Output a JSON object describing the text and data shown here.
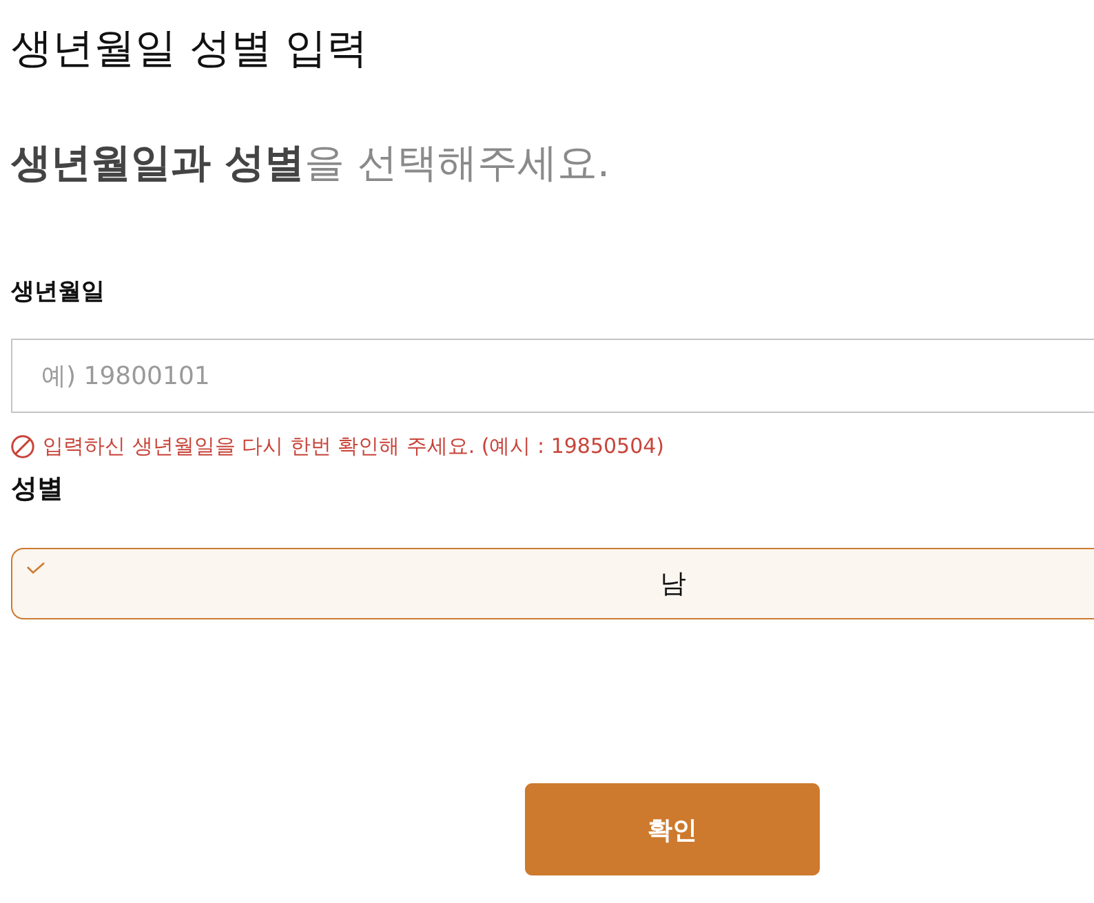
{
  "page": {
    "title": "생년월일 성별 입력",
    "subtitle": "**생년월일과 성별**을 선택해주세요."
  },
  "birthdate": {
    "label": "생년월일",
    "placeholder": "예) 19800101",
    "error": "입력하신 생년월일을 다시 한번 확인해 주세요. (예시 : 19850504)"
  },
  "gender": {
    "label": "성별",
    "options": [
      {
        "label": "남",
        "selected": true
      }
    ]
  },
  "confirm_button": {
    "label": "확인"
  }
}
